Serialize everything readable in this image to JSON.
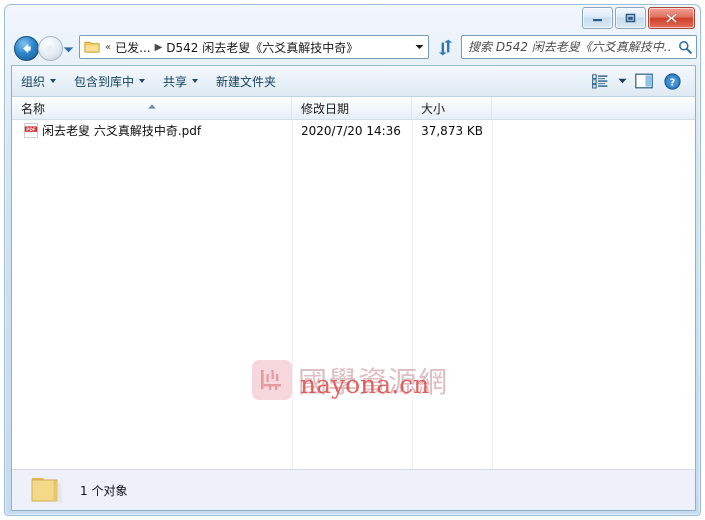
{
  "window": {
    "controls": {
      "minimize_label": "最小化",
      "maximize_label": "最大化",
      "close_label": "关闭"
    }
  },
  "nav": {
    "back_label": "后退",
    "forward_label": "前进",
    "history_label": "最近浏览的位置",
    "refresh_label": "刷新"
  },
  "address": {
    "separator_leading": "«",
    "crumb1": "已发...",
    "separator": "▶",
    "crumb2": "D542 闲去老叟《六爻真解技中奇》",
    "dropdown_label": "▾"
  },
  "search": {
    "placeholder": "搜索 D542 闲去老叟《六爻真解技中...",
    "icon": "search-icon"
  },
  "toolbar": {
    "organize_label": "组织",
    "include_in_library_label": "包含到库中",
    "share_label": "共享",
    "new_folder_label": "新建文件夹",
    "view_icon": "list-view-icon",
    "view_caret": "▾",
    "preview_pane_icon": "preview-pane-icon",
    "help_icon": "help-icon"
  },
  "columns": {
    "name": "名称",
    "date_modified": "修改日期",
    "size": "大小",
    "sort_column": "名称",
    "sort_direction": "ascending"
  },
  "files": [
    {
      "icon": "pdf-file-icon",
      "name": "闲去老叟 六爻真解技中奇.pdf",
      "date_modified": "2020/7/20 14:36",
      "size": "37,873 KB"
    }
  ],
  "watermark": {
    "logo_glyph": "瓿",
    "site_name": "國學資源網",
    "url": "nayona.cn",
    "url_color": "#e04a46",
    "tint_color": "#d8b3ba"
  },
  "status": {
    "folder_icon": "folder-icon",
    "text": "1 个对象"
  }
}
